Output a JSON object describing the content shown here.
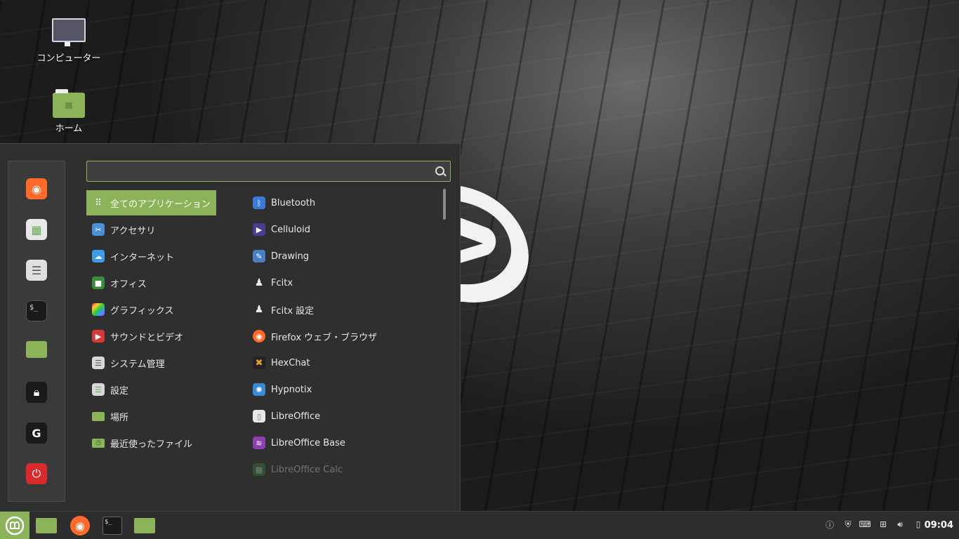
{
  "desktop": {
    "icons": [
      {
        "label": "コンピューター"
      },
      {
        "label": "ホーム"
      }
    ]
  },
  "menu": {
    "search": {
      "value": "",
      "placeholder": ""
    },
    "favorites": [
      "firefox-icon",
      "software-manager-icon",
      "settings-icon",
      "terminal-icon",
      "folder-icon",
      "lock-icon",
      "logout-icon",
      "power-icon"
    ],
    "categories": [
      {
        "label": "全てのアプリケーション",
        "icon": "grid-icon",
        "color": "#8ab35a"
      },
      {
        "label": "アクセサリ",
        "icon": "scissors-icon",
        "color": "#4a90d9"
      },
      {
        "label": "インターネット",
        "icon": "cloud-icon",
        "color": "#3d9be9"
      },
      {
        "label": "オフィス",
        "icon": "office-icon",
        "color": "#3d8b3d"
      },
      {
        "label": "グラフィックス",
        "icon": "color-palette-icon",
        "color": "#c050c0"
      },
      {
        "label": "サウンドとビデオ",
        "icon": "play-icon",
        "color": "#d93838"
      },
      {
        "label": "システム管理",
        "icon": "toggle-icon",
        "color": "#cccccc"
      },
      {
        "label": "設定",
        "icon": "settings-toggle-icon",
        "color": "#cccccc"
      },
      {
        "label": "場所",
        "icon": "folder-icon",
        "color": "#8ab35a"
      },
      {
        "label": "最近使ったファイル",
        "icon": "recent-folder-icon",
        "color": "#8ab35a"
      }
    ],
    "apps": [
      {
        "label": "Bluetooth",
        "icon": "bluetooth-icon",
        "color": "#3a7bd5"
      },
      {
        "label": "Celluloid",
        "icon": "play-icon",
        "color": "#4b3d8f"
      },
      {
        "label": "Drawing",
        "icon": "pencil-icon",
        "color": "#4a7fc1"
      },
      {
        "label": "Fcitx",
        "icon": "penguin-icon",
        "color": "#2f2f2f"
      },
      {
        "label": "Fcitx 設定",
        "icon": "penguin-icon",
        "color": "#2f2f2f"
      },
      {
        "label": "Firefox ウェブ・ブラウザ",
        "icon": "firefox-icon",
        "color": "#ff6a2a"
      },
      {
        "label": "HexChat",
        "icon": "hexchat-icon",
        "color": "#f0a020"
      },
      {
        "label": "Hypnotix",
        "icon": "hypnotix-icon",
        "color": "#3a8ad5"
      },
      {
        "label": "LibreOffice",
        "icon": "document-icon",
        "color": "#dddddd"
      },
      {
        "label": "LibreOffice Base",
        "icon": "database-icon",
        "color": "#8e3fb0"
      },
      {
        "label": "LibreOffice Calc",
        "icon": "spreadsheet-icon",
        "color": "#3d8b3d"
      }
    ]
  },
  "taskbar": {
    "clock": "09:04"
  }
}
